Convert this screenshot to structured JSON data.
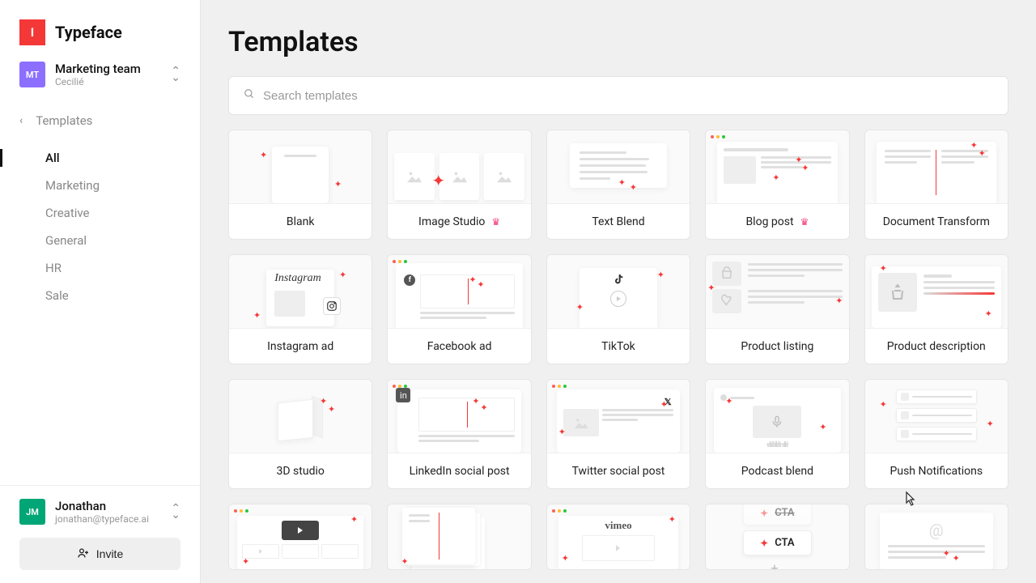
{
  "brand": {
    "mark": "I",
    "name": "Typeface"
  },
  "workspace": {
    "avatar": "MT",
    "name": "Marketing team",
    "user": "Cecilié"
  },
  "nav": {
    "back_label": "Templates",
    "categories": [
      {
        "label": "All",
        "active": true
      },
      {
        "label": "Marketing",
        "active": false
      },
      {
        "label": "Creative",
        "active": false
      },
      {
        "label": "General",
        "active": false
      },
      {
        "label": "HR",
        "active": false
      },
      {
        "label": "Sale",
        "active": false
      }
    ]
  },
  "current_user": {
    "avatar": "JM",
    "name": "Jonathan",
    "email": "jonathan@typeface.ai"
  },
  "invite_label": "Invite",
  "page_title": "Templates",
  "search_placeholder": "Search templates",
  "templates": [
    {
      "key": "blank",
      "label": "Blank",
      "premium": false
    },
    {
      "key": "image-studio",
      "label": "Image Studio",
      "premium": true
    },
    {
      "key": "text-blend",
      "label": "Text Blend",
      "premium": false
    },
    {
      "key": "blog-post",
      "label": "Blog post",
      "premium": true
    },
    {
      "key": "doc-transform",
      "label": "Document Transform",
      "premium": false
    },
    {
      "key": "instagram-ad",
      "label": "Instagram ad",
      "premium": false
    },
    {
      "key": "facebook-ad",
      "label": "Facebook ad",
      "premium": false
    },
    {
      "key": "tiktok",
      "label": "TikTok",
      "premium": false
    },
    {
      "key": "product-listing",
      "label": "Product listing",
      "premium": false
    },
    {
      "key": "product-description",
      "label": "Product description",
      "premium": false
    },
    {
      "key": "3d-studio",
      "label": "3D studio",
      "premium": false
    },
    {
      "key": "linkedin-post",
      "label": "LinkedIn social post",
      "premium": false
    },
    {
      "key": "twitter-post",
      "label": "Twitter social post",
      "premium": false
    },
    {
      "key": "podcast-blend",
      "label": "Podcast blend",
      "premium": false
    },
    {
      "key": "push-notifications",
      "label": "Push Notifications",
      "premium": false
    }
  ],
  "cta_label": "CTA",
  "instagram_word": "Instagram",
  "vimeo_word": "vimeo",
  "colors": {
    "accent": "#f43838",
    "accent_pink": "#f43878"
  }
}
